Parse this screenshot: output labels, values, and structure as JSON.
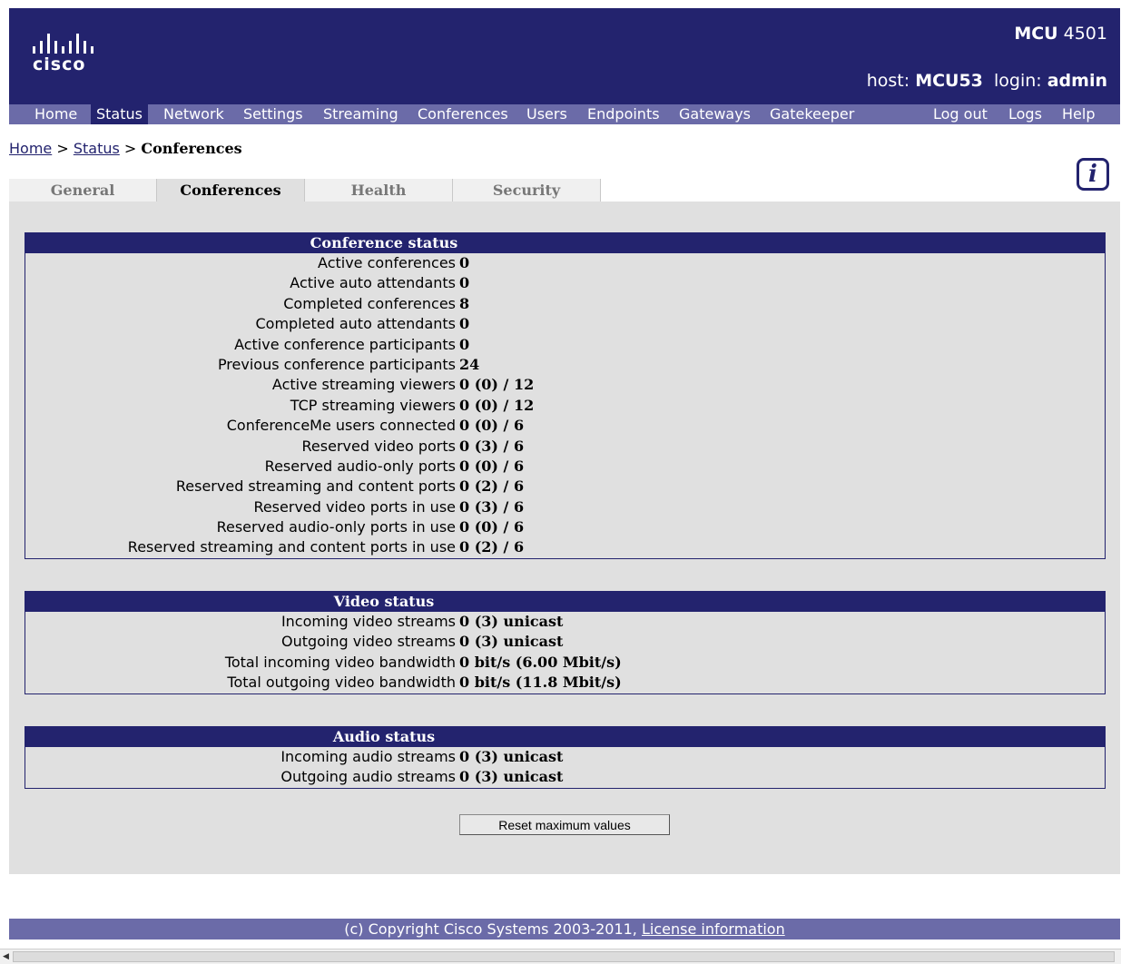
{
  "header": {
    "logo_text": "cisco",
    "model_bold": "MCU",
    "model_num": " 4501",
    "host_label": "host: ",
    "host_value": "MCU53",
    "login_label": "  login: ",
    "login_value": "admin"
  },
  "nav": {
    "items": [
      "Home",
      "Status",
      "Network",
      "Settings",
      "Streaming",
      "Conferences",
      "Users",
      "Endpoints",
      "Gateways",
      "Gatekeeper"
    ],
    "right": [
      "Log out",
      "Logs",
      "Help"
    ]
  },
  "breadcrumb": {
    "home": "Home",
    "sep": " > ",
    "status": "Status",
    "current": "Conferences"
  },
  "tabs": [
    "General",
    "Conferences",
    "Health",
    "Security"
  ],
  "sections": {
    "conference": {
      "title": "Conference status",
      "rows": [
        {
          "label": "Active conferences",
          "value": "0"
        },
        {
          "label": "Active auto attendants",
          "value": "0"
        },
        {
          "label": "Completed conferences",
          "value": "8"
        },
        {
          "label": "Completed auto attendants",
          "value": "0"
        },
        {
          "label": "Active conference participants",
          "value": "0"
        },
        {
          "label": "Previous conference participants",
          "value": "24"
        },
        {
          "label": "Active streaming viewers",
          "value": "0 (0) / 12"
        },
        {
          "label": "TCP streaming viewers",
          "value": "0 (0) / 12"
        },
        {
          "label": "ConferenceMe users connected",
          "value": "0 (0) / 6"
        },
        {
          "label": "Reserved video ports",
          "value": "0 (3) / 6"
        },
        {
          "label": "Reserved audio-only ports",
          "value": "0 (0) / 6"
        },
        {
          "label": "Reserved streaming and content ports",
          "value": "0 (2) / 6"
        },
        {
          "label": "Reserved video ports in use",
          "value": "0 (3) / 6"
        },
        {
          "label": "Reserved audio-only ports in use",
          "value": "0 (0) / 6"
        },
        {
          "label": "Reserved streaming and content ports in use",
          "value": "0 (2) / 6"
        }
      ]
    },
    "video": {
      "title": "Video status",
      "rows": [
        {
          "label": "Incoming video streams",
          "value": "0 (3) unicast"
        },
        {
          "label": "Outgoing video streams",
          "value": "0 (3) unicast"
        },
        {
          "label": "Total incoming video bandwidth",
          "value": "0 bit/s (6.00 Mbit/s)"
        },
        {
          "label": "Total outgoing video bandwidth",
          "value": "0 bit/s (11.8 Mbit/s)"
        }
      ]
    },
    "audio": {
      "title": "Audio status",
      "rows": [
        {
          "label": "Incoming audio streams",
          "value": "0 (3) unicast"
        },
        {
          "label": "Outgoing audio streams",
          "value": "0 (3) unicast"
        }
      ]
    }
  },
  "reset_button": "Reset maximum values",
  "footer": {
    "copyright": "(c) Copyright Cisco Systems 2003-2011, ",
    "license": "License information"
  },
  "colors": {
    "header_bg": "#23236e",
    "nav_bg": "#6b6ba8",
    "panel_bg": "#e0e0e0"
  }
}
